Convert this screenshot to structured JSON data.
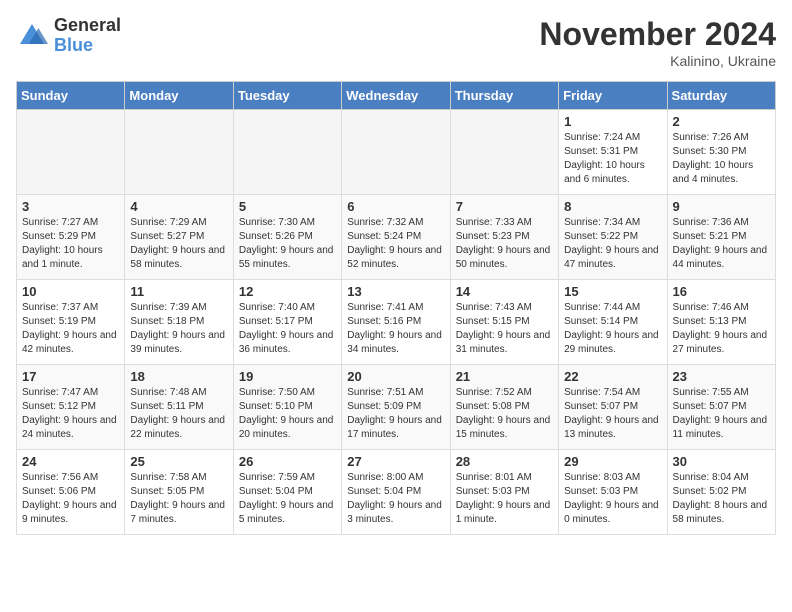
{
  "logo": {
    "general": "General",
    "blue": "Blue"
  },
  "title": "November 2024",
  "subtitle": "Kalinino, Ukraine",
  "days_of_week": [
    "Sunday",
    "Monday",
    "Tuesday",
    "Wednesday",
    "Thursday",
    "Friday",
    "Saturday"
  ],
  "weeks": [
    [
      {
        "day": "",
        "info": ""
      },
      {
        "day": "",
        "info": ""
      },
      {
        "day": "",
        "info": ""
      },
      {
        "day": "",
        "info": ""
      },
      {
        "day": "",
        "info": ""
      },
      {
        "day": "1",
        "info": "Sunrise: 7:24 AM\nSunset: 5:31 PM\nDaylight: 10 hours and 6 minutes."
      },
      {
        "day": "2",
        "info": "Sunrise: 7:26 AM\nSunset: 5:30 PM\nDaylight: 10 hours and 4 minutes."
      }
    ],
    [
      {
        "day": "3",
        "info": "Sunrise: 7:27 AM\nSunset: 5:29 PM\nDaylight: 10 hours and 1 minute."
      },
      {
        "day": "4",
        "info": "Sunrise: 7:29 AM\nSunset: 5:27 PM\nDaylight: 9 hours and 58 minutes."
      },
      {
        "day": "5",
        "info": "Sunrise: 7:30 AM\nSunset: 5:26 PM\nDaylight: 9 hours and 55 minutes."
      },
      {
        "day": "6",
        "info": "Sunrise: 7:32 AM\nSunset: 5:24 PM\nDaylight: 9 hours and 52 minutes."
      },
      {
        "day": "7",
        "info": "Sunrise: 7:33 AM\nSunset: 5:23 PM\nDaylight: 9 hours and 50 minutes."
      },
      {
        "day": "8",
        "info": "Sunrise: 7:34 AM\nSunset: 5:22 PM\nDaylight: 9 hours and 47 minutes."
      },
      {
        "day": "9",
        "info": "Sunrise: 7:36 AM\nSunset: 5:21 PM\nDaylight: 9 hours and 44 minutes."
      }
    ],
    [
      {
        "day": "10",
        "info": "Sunrise: 7:37 AM\nSunset: 5:19 PM\nDaylight: 9 hours and 42 minutes."
      },
      {
        "day": "11",
        "info": "Sunrise: 7:39 AM\nSunset: 5:18 PM\nDaylight: 9 hours and 39 minutes."
      },
      {
        "day": "12",
        "info": "Sunrise: 7:40 AM\nSunset: 5:17 PM\nDaylight: 9 hours and 36 minutes."
      },
      {
        "day": "13",
        "info": "Sunrise: 7:41 AM\nSunset: 5:16 PM\nDaylight: 9 hours and 34 minutes."
      },
      {
        "day": "14",
        "info": "Sunrise: 7:43 AM\nSunset: 5:15 PM\nDaylight: 9 hours and 31 minutes."
      },
      {
        "day": "15",
        "info": "Sunrise: 7:44 AM\nSunset: 5:14 PM\nDaylight: 9 hours and 29 minutes."
      },
      {
        "day": "16",
        "info": "Sunrise: 7:46 AM\nSunset: 5:13 PM\nDaylight: 9 hours and 27 minutes."
      }
    ],
    [
      {
        "day": "17",
        "info": "Sunrise: 7:47 AM\nSunset: 5:12 PM\nDaylight: 9 hours and 24 minutes."
      },
      {
        "day": "18",
        "info": "Sunrise: 7:48 AM\nSunset: 5:11 PM\nDaylight: 9 hours and 22 minutes."
      },
      {
        "day": "19",
        "info": "Sunrise: 7:50 AM\nSunset: 5:10 PM\nDaylight: 9 hours and 20 minutes."
      },
      {
        "day": "20",
        "info": "Sunrise: 7:51 AM\nSunset: 5:09 PM\nDaylight: 9 hours and 17 minutes."
      },
      {
        "day": "21",
        "info": "Sunrise: 7:52 AM\nSunset: 5:08 PM\nDaylight: 9 hours and 15 minutes."
      },
      {
        "day": "22",
        "info": "Sunrise: 7:54 AM\nSunset: 5:07 PM\nDaylight: 9 hours and 13 minutes."
      },
      {
        "day": "23",
        "info": "Sunrise: 7:55 AM\nSunset: 5:07 PM\nDaylight: 9 hours and 11 minutes."
      }
    ],
    [
      {
        "day": "24",
        "info": "Sunrise: 7:56 AM\nSunset: 5:06 PM\nDaylight: 9 hours and 9 minutes."
      },
      {
        "day": "25",
        "info": "Sunrise: 7:58 AM\nSunset: 5:05 PM\nDaylight: 9 hours and 7 minutes."
      },
      {
        "day": "26",
        "info": "Sunrise: 7:59 AM\nSunset: 5:04 PM\nDaylight: 9 hours and 5 minutes."
      },
      {
        "day": "27",
        "info": "Sunrise: 8:00 AM\nSunset: 5:04 PM\nDaylight: 9 hours and 3 minutes."
      },
      {
        "day": "28",
        "info": "Sunrise: 8:01 AM\nSunset: 5:03 PM\nDaylight: 9 hours and 1 minute."
      },
      {
        "day": "29",
        "info": "Sunrise: 8:03 AM\nSunset: 5:03 PM\nDaylight: 9 hours and 0 minutes."
      },
      {
        "day": "30",
        "info": "Sunrise: 8:04 AM\nSunset: 5:02 PM\nDaylight: 8 hours and 58 minutes."
      }
    ]
  ]
}
